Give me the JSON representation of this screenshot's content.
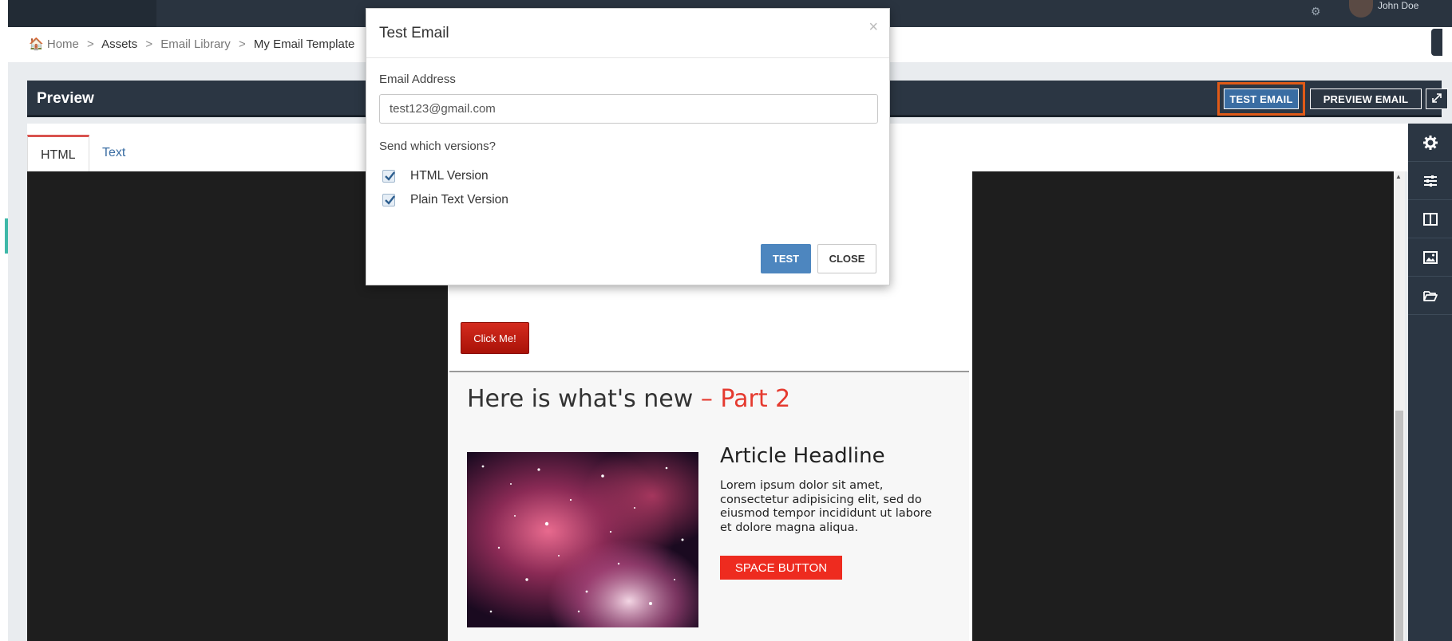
{
  "topbar": {
    "user_name": "John Doe",
    "icons": [
      "bell-icon",
      "avatar"
    ]
  },
  "breadcrumb": {
    "home": "Home",
    "assets": "Assets",
    "email_library": "Email Library",
    "current": "My Email Template",
    "separator": ">"
  },
  "preview": {
    "title": "Preview",
    "test_email_label": "TEST EMAIL",
    "preview_email_label": "PREVIEW EMAIL",
    "expand_icon": "expand-icon"
  },
  "tabs": [
    {
      "label": "HTML",
      "active": true
    },
    {
      "label": "Text",
      "active": false
    }
  ],
  "sidebar": {
    "icons": [
      "gear-icon",
      "sliders-icon",
      "columns-icon",
      "image-icon",
      "folder-open-icon"
    ]
  },
  "email_content": {
    "click_button_label": "Click Me!",
    "section_heading": "Here is what's new",
    "section_heading_accent": "– Part 2",
    "article_title": "Article Headline",
    "article_body": "Lorem ipsum dolor sit amet, consectetur adipisicing elit, sed do eiusmod tempor incididunt ut labore et dolore magna aliqua.",
    "space_button_label": "SPACE BUTTON"
  },
  "modal": {
    "title": "Test Email",
    "close_glyph": "×",
    "email_label": "Email Address",
    "email_value": "test123@gmail.com",
    "versions_label": "Send which versions?",
    "options": [
      {
        "label": "HTML Version",
        "checked": true
      },
      {
        "label": "Plain Text Version",
        "checked": true
      }
    ],
    "test_button": "TEST",
    "close_button": "CLOSE"
  },
  "colors": {
    "accent_red": "#e53a2f",
    "header_dark": "#2b3643",
    "primary_blue": "#4d86bf",
    "highlight_orange": "#e05a17"
  }
}
